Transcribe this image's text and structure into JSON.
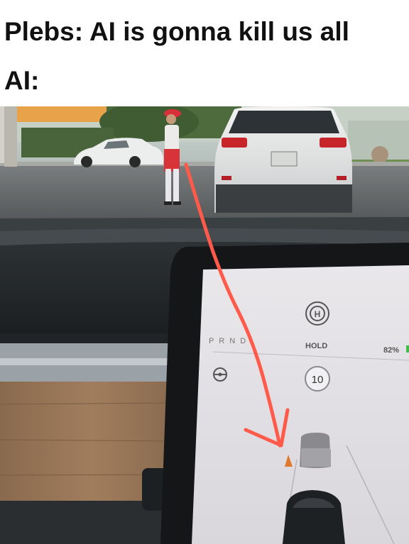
{
  "meme": {
    "line1": "Plebs: AI is gonna kill us all",
    "line2": "AI:"
  },
  "screen": {
    "hold_symbol": "H",
    "gear": "P R N D",
    "hold_label": "HOLD",
    "battery": "82%",
    "speed_limit": "10"
  },
  "annotation": {
    "arrow_color": "#ff5a4a"
  }
}
